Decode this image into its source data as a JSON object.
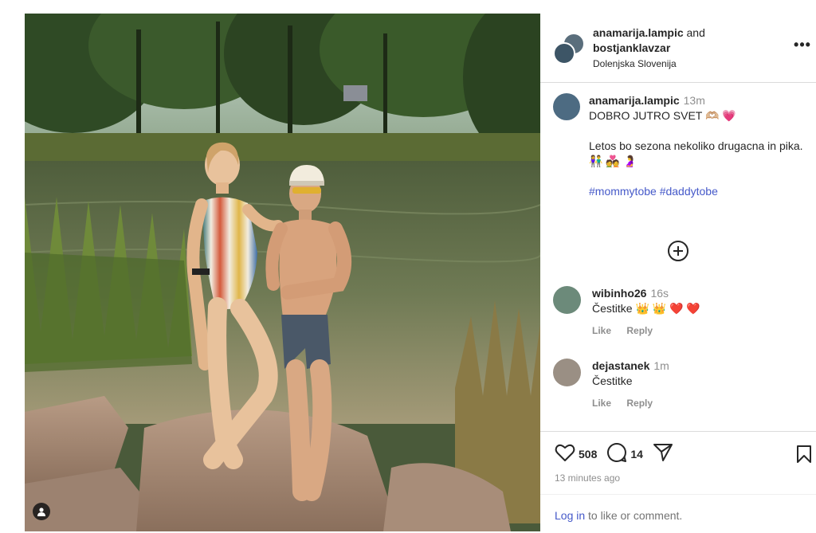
{
  "post": {
    "header": {
      "user1": "anamarija.lampic",
      "joiner": "and",
      "user2": "bostjanklavzar",
      "location": "Dolenjska Slovenija",
      "more": "•••"
    },
    "caption": {
      "username": "anamarija.lampic",
      "time": "13m",
      "line1": "DOBRO JUTRO SVET 🫶🏼 💗",
      "line2": "Letos bo sezona nekoliko drugacna in pika.",
      "line3": "👫 💑 🤰",
      "hashtags": "#mommytobe #daddytobe"
    },
    "comments": [
      {
        "username": "wibinho26",
        "time": "16s",
        "text": "Čestitke 👑 👑 ❤️ ❤️",
        "like": "Like",
        "reply": "Reply"
      },
      {
        "username": "dejastanek",
        "time": "1m",
        "text": "Čestitke",
        "like": "Like",
        "reply": "Reply"
      }
    ],
    "actions": {
      "likes": "508",
      "comments": "14",
      "time_ago": "13 minutes ago"
    },
    "login": {
      "link": "Log in",
      "rest": " to like or comment."
    }
  },
  "icons": {
    "user_tag": "user-icon",
    "more": "more-icon",
    "add_comments": "plus-circle-icon",
    "like": "heart-icon",
    "comment": "comment-icon",
    "share": "send-icon",
    "save": "bookmark-icon"
  },
  "colors": {
    "link": "#4559c9",
    "muted": "#8e8e8e",
    "text": "#262626",
    "border": "#dbdbdb"
  }
}
